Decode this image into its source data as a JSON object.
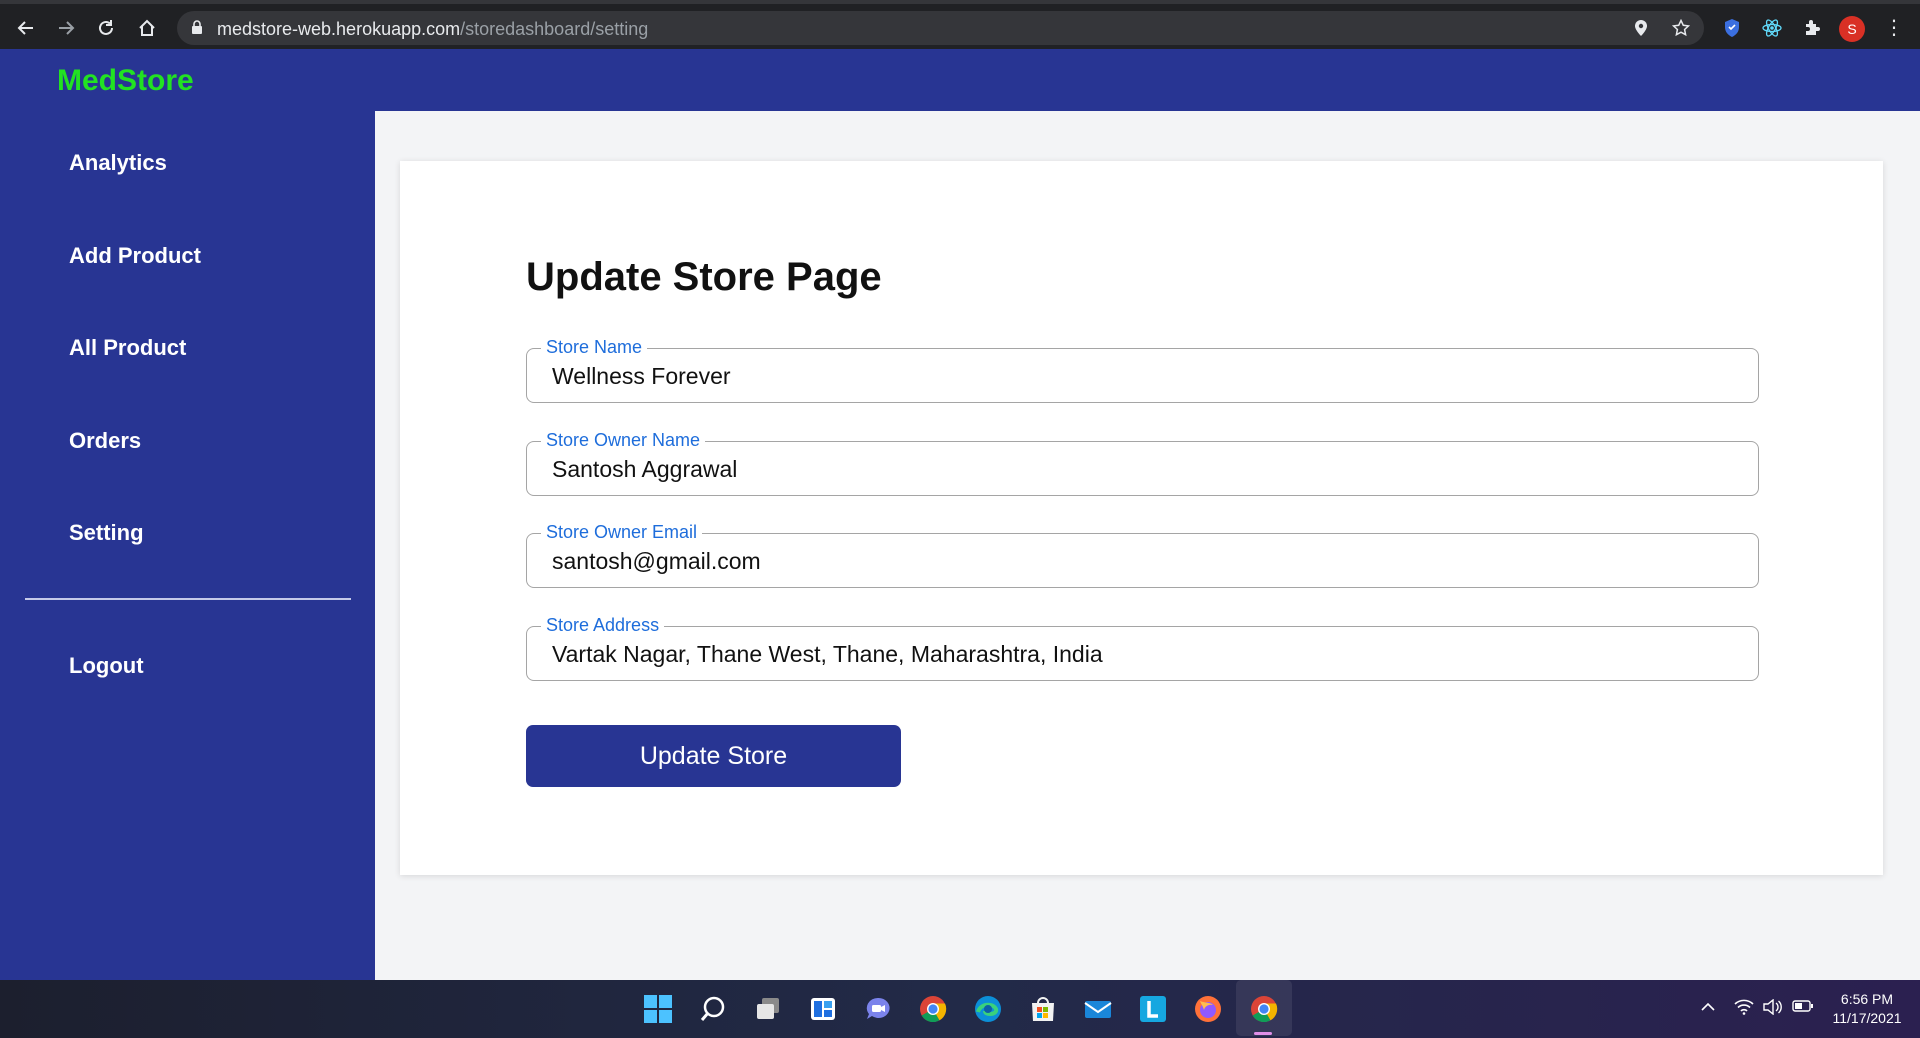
{
  "browser": {
    "url_host": "medstore-web.herokuapp.com",
    "url_path": "/storedashboard/setting",
    "profile_initial": "S"
  },
  "app": {
    "brand": "MedStore",
    "brand_color": "#22e222",
    "primary_color": "#283593"
  },
  "sidebar": {
    "items": [
      {
        "label": "Analytics"
      },
      {
        "label": "Add Product"
      },
      {
        "label": "All Product"
      },
      {
        "label": "Orders"
      },
      {
        "label": "Setting"
      }
    ],
    "logout_label": "Logout"
  },
  "form": {
    "title": "Update Store Page",
    "fields": [
      {
        "label": "Store Name",
        "value": "Wellness Forever"
      },
      {
        "label": "Store Owner Name",
        "value": "Santosh Aggrawal"
      },
      {
        "label": "Store Owner Email",
        "value": "santosh@gmail.com"
      },
      {
        "label": "Store Address",
        "value": "Vartak Nagar, Thane West, Thane, Maharashtra, India"
      }
    ],
    "submit_label": "Update Store"
  },
  "taskbar": {
    "icons": [
      "start-icon",
      "search-icon",
      "task-view-icon",
      "widgets-icon",
      "teams-chat-icon",
      "chrome-icon",
      "edge-icon",
      "store-icon",
      "mail-icon",
      "l-app-icon",
      "firefox-icon",
      "chrome-active-icon"
    ],
    "time": "6:56 PM",
    "date": "11/17/2021"
  }
}
